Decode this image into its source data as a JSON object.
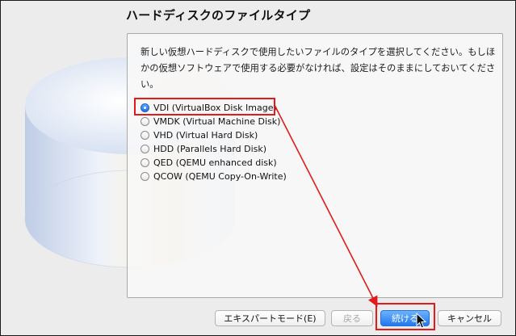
{
  "dialog": {
    "title": "ハードディスクのファイルタイプ",
    "description": "新しい仮想ハードディスクで使用したいファイルのタイプを選択してください。もしほかの仮想ソフトウェアで使用する必要がなければ、設定はそのままにしておいてください。"
  },
  "file_types": [
    {
      "label": "VDI (VirtualBox Disk Image)",
      "selected": true
    },
    {
      "label": "VMDK (Virtual Machine Disk)",
      "selected": false
    },
    {
      "label": "VHD (Virtual Hard Disk)",
      "selected": false
    },
    {
      "label": "HDD (Parallels Hard Disk)",
      "selected": false
    },
    {
      "label": "QED (QEMU enhanced disk)",
      "selected": false
    },
    {
      "label": "QCOW (QEMU Copy-On-Write)",
      "selected": false
    }
  ],
  "buttons": {
    "expert": "エキスパートモード(E)",
    "back": "戻る",
    "continue": "続ける",
    "cancel": "キャンセル"
  },
  "colors": {
    "annotation_red": "#e11b1b",
    "primary_blue": "#1f78ee"
  },
  "icons": {
    "illustration": "hard-disk-cylinder-illustration",
    "cursor": "mouse-pointer-icon"
  }
}
